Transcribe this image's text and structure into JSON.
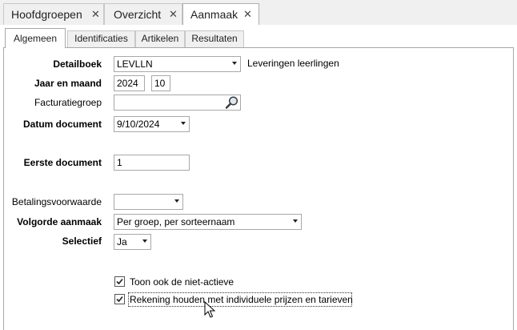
{
  "top_tabs": [
    {
      "label": "Hoofdgroepen",
      "active": false
    },
    {
      "label": "Overzicht",
      "active": false
    },
    {
      "label": "Aanmaak",
      "active": true
    }
  ],
  "close_glyph": "✕",
  "sub_tabs": [
    {
      "label": "Algemeen",
      "active": true
    },
    {
      "label": "Identificaties",
      "active": false
    },
    {
      "label": "Artikelen",
      "active": false
    },
    {
      "label": "Resultaten",
      "active": false
    }
  ],
  "form": {
    "detailboek": {
      "label": "Detailboek",
      "value": "LEVLLN",
      "description": "Leveringen leerlingen"
    },
    "jaar_maand": {
      "label": "Jaar en maand",
      "year": "2024",
      "month": "10"
    },
    "facturatiegroep": {
      "label": "Facturatiegroep",
      "value": ""
    },
    "datum_document": {
      "label": "Datum document",
      "value": "9/10/2024"
    },
    "eerste_document": {
      "label": "Eerste document",
      "value": "1"
    },
    "betalingsvoorwaarde": {
      "label": "Betalingsvoorwaarde",
      "value": ""
    },
    "volgorde_aanmaak": {
      "label": "Volgorde aanmaak",
      "value": "Per groep, per sorteernaam"
    },
    "selectief": {
      "label": "Selectief",
      "value": "Ja"
    }
  },
  "checkboxes": [
    {
      "label": "Toon ook de niet-actieve",
      "checked": true
    },
    {
      "label": "Rekening houden met individuele prijzen en tarieven",
      "checked": true
    }
  ],
  "colors": {
    "tab_border": "#c8c8c8",
    "active_bg": "#ffffff",
    "window_bg": "#f0f0f0"
  },
  "icons": [
    "close-icon",
    "search-icon",
    "dropdown-arrow-icon",
    "checkbox-checked-icon",
    "mouse-cursor-icon"
  ]
}
